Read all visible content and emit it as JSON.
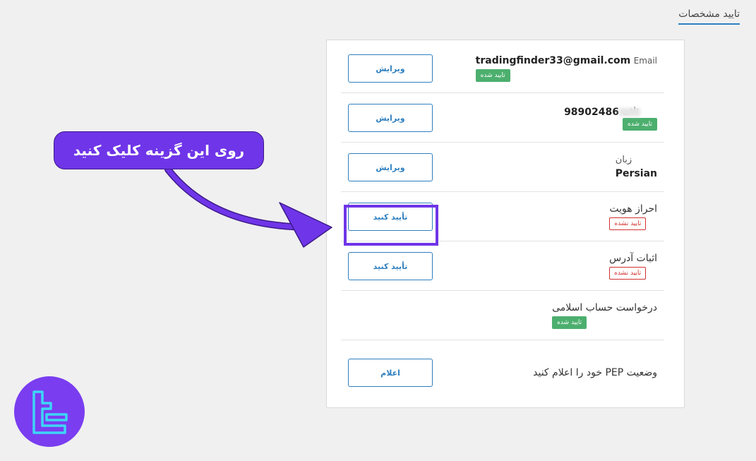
{
  "header": {
    "tab_label": "تایید مشخصات"
  },
  "rows": [
    {
      "label": "Email",
      "value": "tradingfinder33@gmail.com",
      "badge": "تایید شده",
      "badge_status": "verified",
      "button": "ویرایش"
    },
    {
      "label": "تلفن",
      "value": "98902486",
      "badge": "تایید شده",
      "badge_status": "verified",
      "button": "ویرایش"
    },
    {
      "label": "زبان",
      "value": "Persian",
      "button": "ویرایش"
    },
    {
      "title": "احراز هویت",
      "badge": "تایید نشده",
      "badge_status": "not-verified",
      "button": "تأیید کنید"
    },
    {
      "title": "اثبات آدرس",
      "badge": "تایید نشده",
      "badge_status": "not-verified",
      "button": "تأیید کنید"
    },
    {
      "title": "درخواست حساب اسلامی",
      "badge": "تایید شده",
      "badge_status": "verified"
    },
    {
      "title": "وضعیت PEP خود را اعلام کنید",
      "button": "اعلام"
    }
  ],
  "annotation": {
    "callout_text": "روی این گزینه کلیک کنید"
  },
  "colors": {
    "accent": "#2f7fbf",
    "verified": "#4caf6e",
    "not_verified": "#d32f2f",
    "annotation": "#6f35e8",
    "logo_bg": "#7a3df0",
    "logo_fg": "#3cd6f5"
  },
  "icons": {
    "logo": "tradingfinder-logo-icon",
    "arrow": "curved-arrow-icon"
  }
}
